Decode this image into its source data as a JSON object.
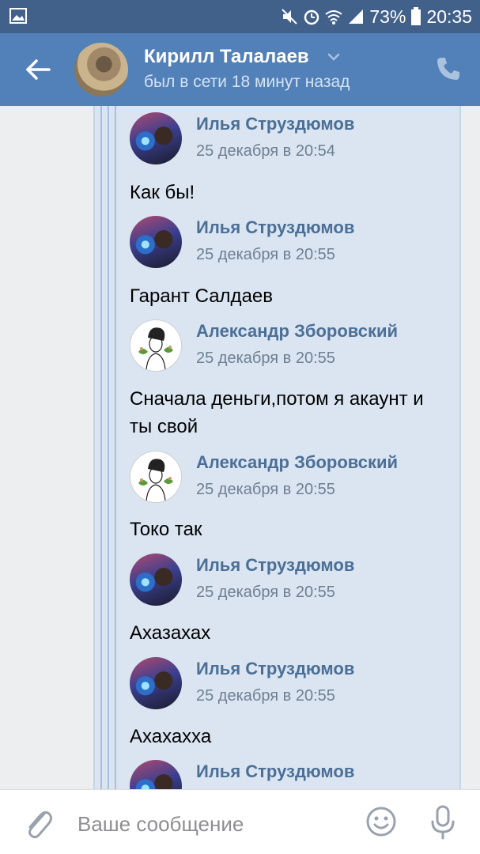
{
  "status_bar": {
    "battery": "73%",
    "time": "20:35"
  },
  "header": {
    "contact_name": "Кирилл Талалаев",
    "contact_status": "был в сети 18 минут назад"
  },
  "messages": [
    {
      "sender": "Илья Струздюмов",
      "time": "25 декабря в 20:54",
      "text": "Как бы!",
      "avatar": "ilya"
    },
    {
      "sender": "Илья Струздюмов",
      "time": "25 декабря в 20:55",
      "text": "Гарант Салдаев",
      "avatar": "ilya"
    },
    {
      "sender": "Александр Зборовский",
      "time": "25 декабря в 20:55",
      "text": "Сначала деньги,потом я акаунт и ты свой",
      "avatar": "alex"
    },
    {
      "sender": "Александр Зборовский",
      "time": "25 декабря в 20:55",
      "text": "Токо так",
      "avatar": "alex"
    },
    {
      "sender": "Илья Струздюмов",
      "time": "25 декабря в 20:55",
      "text": "Ахазахах",
      "avatar": "ilya"
    },
    {
      "sender": "Илья Струздюмов",
      "time": "25 декабря в 20:55",
      "text": "Ахахахха",
      "avatar": "ilya"
    },
    {
      "sender": "Илья Струздюмов",
      "time": "",
      "text": "",
      "avatar": "ilya"
    }
  ],
  "composer": {
    "placeholder": "Ваше сообщение"
  },
  "colors": {
    "status_bar": "#41618b",
    "header": "#5181b8",
    "forward_panel": "#dae5f1",
    "sender_name": "#4b6f96"
  }
}
